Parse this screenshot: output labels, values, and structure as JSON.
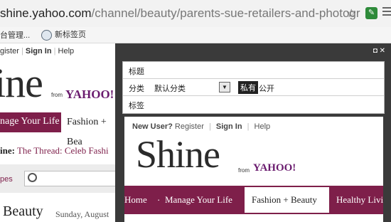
{
  "browser": {
    "url_host": "shine.yahoo.com",
    "url_path": "/channel/beauty/parents-sue-retailers-and-photogr",
    "bookmarks": [
      "台管理...",
      "新标签页"
    ]
  },
  "bg_page": {
    "top_links": [
      "gister",
      "Sign In",
      "Help"
    ],
    "logo_text": "ine",
    "from_text": "from",
    "yahoo_text": "YAHOO!",
    "nav_items": [
      "nage Your Life",
      "Fashion + Bea"
    ],
    "thread_prefix": "ine:",
    "thread_text": "The Thread: Celeb Fashi",
    "search_prefix": "pes",
    "heading": "Beauty",
    "date": "Sunday, August"
  },
  "panel": {
    "controls": "◘ ✕",
    "form": {
      "title_label": "标题",
      "category_label": "分类",
      "category_value": "默认分类",
      "private_label": "私有",
      "public_label": "公开",
      "tags_label": "标签"
    },
    "preview": {
      "new_user": "New User?",
      "register": "Register",
      "sign_in": "Sign In",
      "help": "Help",
      "logo_text": "Shine",
      "from_text": "from",
      "yahoo_text": "YAHOO!",
      "nav": {
        "home": "Home",
        "dot": "·",
        "manage": "Manage Your Life",
        "fashion": "Fashion + Beauty",
        "healthy": "Healthy Livi"
      }
    }
  }
}
